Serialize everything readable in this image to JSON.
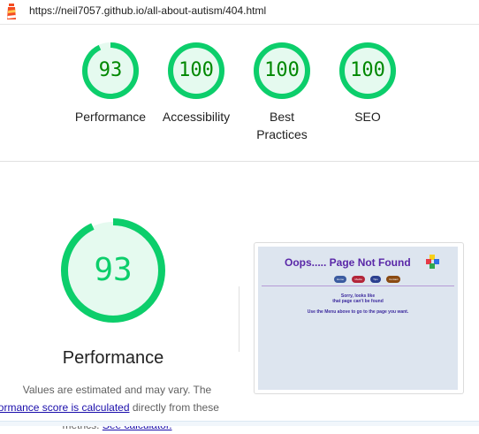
{
  "topbar": {
    "url": "https://neil7057.github.io/all-about-autism/404.html",
    "logo_icon": "lighthouse-icon"
  },
  "colors": {
    "pass": "#0cce6b",
    "pass_text": "#008800",
    "pass_fill": "#e5faef",
    "link": "#1a0dab"
  },
  "scores": [
    {
      "value": "93",
      "label": "Performance"
    },
    {
      "value": "100",
      "label": "Accessibility"
    },
    {
      "value": "100",
      "label": "Best",
      "label2": "Practices"
    },
    {
      "value": "100",
      "label": "SEO"
    }
  ],
  "detail": {
    "score": "93",
    "title": "Performance",
    "note_text": "Values are estimated and may vary. The",
    "note_link": "performance score is calculated",
    "note_tail": "directly from these",
    "note_line3_start": "metrics.",
    "note_line3_link": "See calculator."
  },
  "screenshot": {
    "title": "Oops..... Page Not Found",
    "nav": [
      "Home",
      "Media",
      "Tips",
      "Contact"
    ],
    "msg1": "Sorry, looks like",
    "msg2": "that page can't be found",
    "msg3": "Use the Menu above to go to the page you want."
  }
}
